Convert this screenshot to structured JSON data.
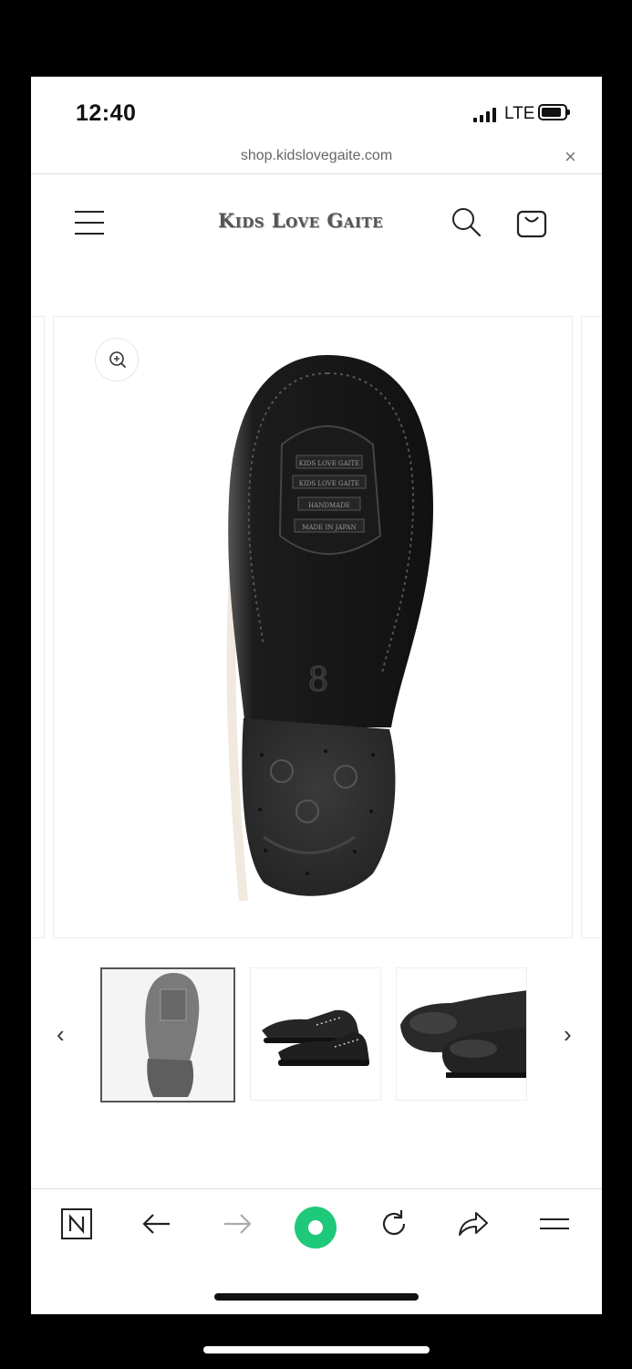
{
  "status_bar": {
    "time": "12:40",
    "network": "LTE"
  },
  "browser": {
    "url": "shop.kidslovegaite.com",
    "close_symbol": "×"
  },
  "header": {
    "logo": "Kids Love Gaite"
  },
  "product": {
    "sole_stamp_lines": [
      "KIDS LOVE GAITE",
      "KIDS LOVE GAITE",
      "HANDMADE",
      "MADE IN JAPAN"
    ],
    "sole_size": "8"
  },
  "gallery_nav": {
    "prev": "‹",
    "next": "›"
  },
  "icons": {
    "menu": "hamburger-icon",
    "search": "search-icon",
    "cart": "cart-icon",
    "zoom": "zoom-in-icon",
    "toolbar": [
      "n-logo-icon",
      "back-arrow-icon",
      "forward-arrow-icon",
      "record-icon",
      "reload-icon",
      "share-icon",
      "menu-icon"
    ]
  },
  "colors": {
    "accent_green": "#1fc97a",
    "sole_black": "#1a1a1a"
  }
}
